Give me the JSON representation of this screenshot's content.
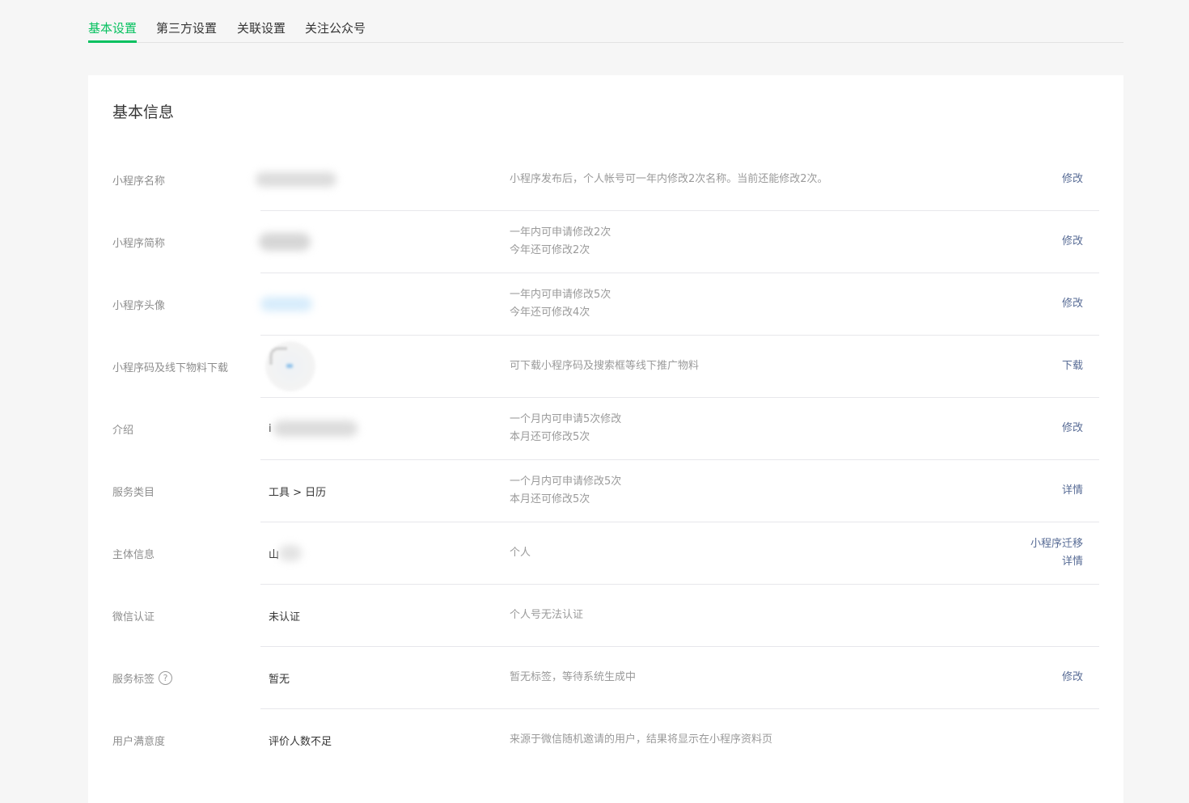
{
  "tabs": [
    {
      "label": "基本设置",
      "active": true
    },
    {
      "label": "第三方设置",
      "active": false
    },
    {
      "label": "关联设置",
      "active": false
    },
    {
      "label": "关注公众号",
      "active": false
    }
  ],
  "card": {
    "title": "基本信息",
    "rows": [
      {
        "label": "小程序名称",
        "value": "",
        "desc": [
          "小程序发布后，个人帐号可一年内修改2次名称。当前还能修改2次。"
        ],
        "actions": [
          "修改"
        ]
      },
      {
        "label": "小程序简称",
        "value": "",
        "desc": [
          "一年内可申请修改2次",
          "今年还可修改2次"
        ],
        "actions": [
          "修改"
        ]
      },
      {
        "label": "小程序头像",
        "value": "",
        "desc": [
          "一年内可申请修改5次",
          "今年还可修改4次"
        ],
        "actions": [
          "修改"
        ]
      },
      {
        "label": "小程序码及线下物料下载",
        "value": "",
        "desc": [
          "可下载小程序码及搜索框等线下推广物料"
        ],
        "actions": [
          "下载"
        ]
      },
      {
        "label": "介绍",
        "value": "i",
        "desc": [
          "一个月内可申请5次修改",
          "本月还可修改5次"
        ],
        "actions": [
          "修改"
        ]
      },
      {
        "label": "服务类目",
        "value": "工具 > 日历",
        "desc": [
          "一个月内可申请修改5次",
          "本月还可修改5次"
        ],
        "actions": [
          "详情"
        ]
      },
      {
        "label": "主体信息",
        "value": "山",
        "desc": [
          "个人"
        ],
        "actions": [
          "小程序迁移",
          "详情"
        ]
      },
      {
        "label": "微信认证",
        "value": "未认证",
        "desc": [
          "个人号无法认证"
        ],
        "actions": []
      },
      {
        "label": "服务标签",
        "value": "暂无",
        "desc": [
          "暂无标签，等待系统生成中"
        ],
        "actions": [
          "修改"
        ]
      },
      {
        "label": "用户满意度",
        "value": "评价人数不足",
        "desc": [
          "来源于微信随机邀请的用户，结果将显示在小程序资料页"
        ],
        "actions": []
      }
    ]
  },
  "icons": {
    "help": "question-circle-icon",
    "help_glyph": "?"
  },
  "colors": {
    "accent": "#07c160",
    "link": "#576b95",
    "label": "#8d8d8d",
    "desc": "#9a9a9a"
  }
}
